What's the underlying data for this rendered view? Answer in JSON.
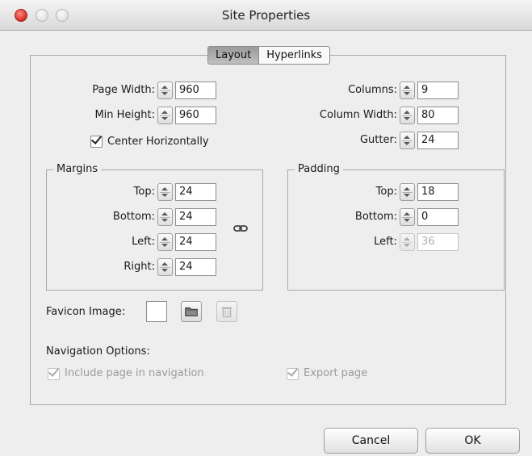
{
  "window": {
    "title": "Site Properties"
  },
  "tabs": [
    {
      "label": "Layout",
      "active": true
    },
    {
      "label": "Hyperlinks",
      "active": false
    }
  ],
  "layout": {
    "page_width": {
      "label": "Page Width:",
      "value": "960"
    },
    "min_height": {
      "label": "Min Height:",
      "value": "960"
    },
    "center_horizontally": {
      "label": "Center Horizontally",
      "checked": true
    },
    "columns": {
      "label": "Columns:",
      "value": "9"
    },
    "column_width": {
      "label": "Column Width:",
      "value": "80"
    },
    "gutter": {
      "label": "Gutter:",
      "value": "24"
    }
  },
  "margins": {
    "title": "Margins",
    "top": {
      "label": "Top:",
      "value": "24"
    },
    "bottom": {
      "label": "Bottom:",
      "value": "24"
    },
    "left": {
      "label": "Left:",
      "value": "24"
    },
    "right": {
      "label": "Right:",
      "value": "24"
    }
  },
  "padding": {
    "title": "Padding",
    "top": {
      "label": "Top:",
      "value": "18"
    },
    "bottom": {
      "label": "Bottom:",
      "value": "0"
    },
    "left": {
      "label": "Left:",
      "value": "36",
      "disabled": true
    }
  },
  "favicon": {
    "label": "Favicon Image:"
  },
  "navigation": {
    "title": "Navigation Options:",
    "include_in_navigation": {
      "label": "Include page in navigation",
      "checked": true,
      "disabled": true
    },
    "export_page": {
      "label": "Export page",
      "checked": true,
      "disabled": true
    }
  },
  "buttons": {
    "cancel": "Cancel",
    "ok": "OK"
  },
  "icons": {
    "close": "close-icon",
    "minimize": "minimize-icon",
    "maximize": "maximize-icon",
    "link": "link-icon",
    "folder": "folder-icon",
    "trash": "trash-icon"
  },
  "colors": {
    "close_red": "#d9302a",
    "panel_bg": "#eeeeee",
    "active_tab": "#a9a9a9"
  }
}
